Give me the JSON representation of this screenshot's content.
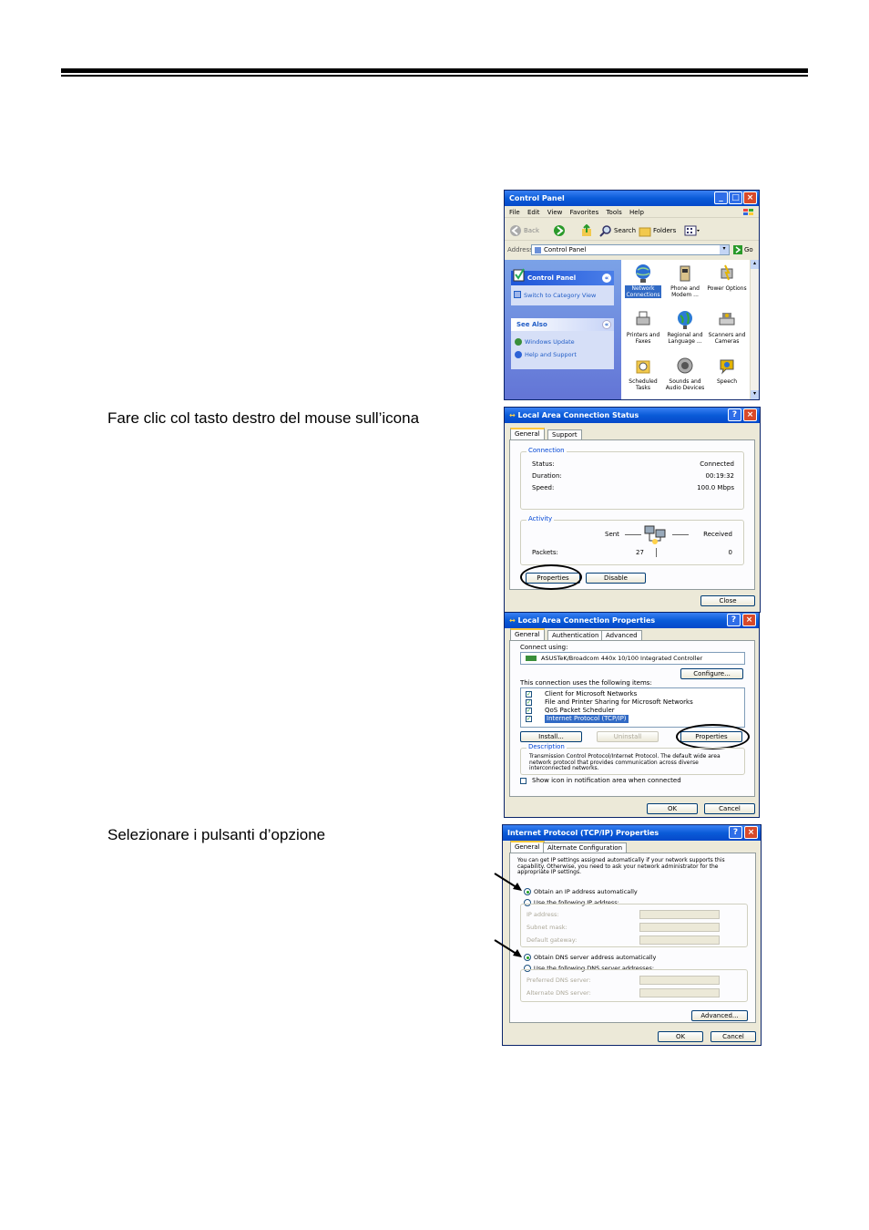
{
  "instructions": [
    "Fare clic col tasto destro del mouse sull’icona",
    "Selezionare i pulsanti d’opzione"
  ],
  "control_panel": {
    "title": "Control Panel",
    "menu": [
      "File",
      "Edit",
      "View",
      "Favorites",
      "Tools",
      "Help"
    ],
    "toolbar": {
      "back": "Back",
      "search": "Search",
      "folders": "Folders"
    },
    "address_label": "Address",
    "address_value": "Control Panel",
    "go": "Go",
    "side_title": "Control Panel",
    "side_link": "Switch to Category View",
    "see_also": "See Also",
    "see_also_links": [
      "Windows Update",
      "Help and Support"
    ],
    "icons": [
      {
        "label": "Network Connections",
        "icon": "network-icon"
      },
      {
        "label": "Phone and Modem ...",
        "icon": "phone-icon"
      },
      {
        "label": "Power Options",
        "icon": "power-icon"
      },
      {
        "label": "Printers and Faxes",
        "icon": "printer-icon"
      },
      {
        "label": "Regional and Language ...",
        "icon": "globe-icon"
      },
      {
        "label": "Scanners and Cameras",
        "icon": "scanner-icon"
      },
      {
        "label": "Scheduled Tasks",
        "icon": "tasks-icon"
      },
      {
        "label": "Sounds and Audio Devices",
        "icon": "speaker-icon"
      },
      {
        "label": "Speech",
        "icon": "speech-icon"
      }
    ]
  },
  "status_dialog": {
    "title": "Local Area Connection Status",
    "tabs": [
      "General",
      "Support"
    ],
    "connection_group": "Connection",
    "rows": [
      {
        "label": "Status:",
        "value": "Connected"
      },
      {
        "label": "Duration:",
        "value": "00:19:32"
      },
      {
        "label": "Speed:",
        "value": "100.0 Mbps"
      }
    ],
    "activity_group": "Activity",
    "sent": "Sent",
    "received": "Received",
    "packets_label": "Packets:",
    "packets_sent": "27",
    "packets_received": "0",
    "properties": "Properties",
    "disable": "Disable",
    "close": "Close"
  },
  "props_dialog": {
    "title": "Local Area Connection Properties",
    "tabs": [
      "General",
      "Authentication",
      "Advanced"
    ],
    "connect_using": "Connect using:",
    "adapter": "ASUSTeK/Broadcom 440x 10/100 Integrated Controller",
    "configure": "Configure...",
    "items_label": "This connection uses the following items:",
    "items": [
      "Client for Microsoft Networks",
      "File and Printer Sharing for Microsoft Networks",
      "QoS Packet Scheduler",
      "Internet Protocol (TCP/IP)"
    ],
    "install": "Install...",
    "uninstall": "Uninstall",
    "properties": "Properties",
    "description_label": "Description",
    "description": "Transmission Control Protocol/Internet Protocol. The default wide area network protocol that provides communication across diverse interconnected networks.",
    "show_icon": "Show icon in notification area when connected",
    "ok": "OK",
    "cancel": "Cancel"
  },
  "tcpip_dialog": {
    "title": "Internet Protocol (TCP/IP) Properties",
    "tabs": [
      "General",
      "Alternate Configuration"
    ],
    "intro": "You can get IP settings assigned automatically if your network supports this capability. Otherwise, you need to ask your network administrator for the appropriate IP settings.",
    "auto_ip": "Obtain an IP address automatically",
    "manual_ip": "Use the following IP address:",
    "ip_fields": [
      "IP address:",
      "Subnet mask:",
      "Default gateway:"
    ],
    "auto_dns": "Obtain DNS server address automatically",
    "manual_dns": "Use the following DNS server addresses:",
    "dns_fields": [
      "Preferred DNS server:",
      "Alternate DNS server:"
    ],
    "advanced": "Advanced...",
    "ok": "OK",
    "cancel": "Cancel"
  }
}
